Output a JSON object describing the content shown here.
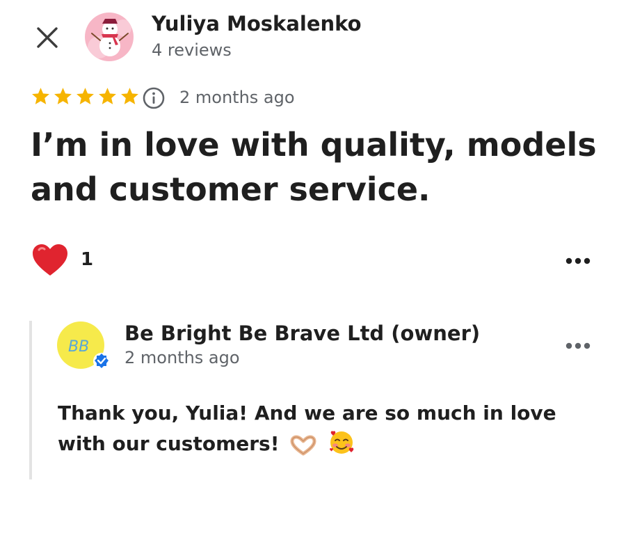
{
  "header": {
    "reviewer_name": "Yuliya Moskalenko",
    "reviewer_meta": "4 reviews",
    "close_icon": "close-icon",
    "avatar_icon": "snowman-avatar"
  },
  "review": {
    "rating": 5,
    "rating_max": 5,
    "date": "2 months ago",
    "text": "I’m in love with quality, models and customer service.",
    "like_count": "1",
    "icons": [
      "star-icon",
      "info-icon",
      "heart-icon",
      "more-options-icon"
    ]
  },
  "reply": {
    "owner_name": "Be Bright Be Brave Ltd (owner)",
    "owner_avatar_text": "BB",
    "date": "2 months ago",
    "text": "Thank you, Yulia! And we are so much in love with our customers!",
    "emojis": [
      "heart-hands-emoji",
      "smiling-face-with-hearts-emoji"
    ],
    "icons": [
      "verified-badge-icon",
      "more-options-icon"
    ]
  },
  "colors": {
    "star": "#f6b400",
    "text_primary": "#1f1f1f",
    "text_secondary": "#5f6368",
    "heart": "#e0242f",
    "verified": "#1a73e8",
    "owner_avatar_bg": "#f6ea4b",
    "reply_bar": "#e3e3e3"
  }
}
